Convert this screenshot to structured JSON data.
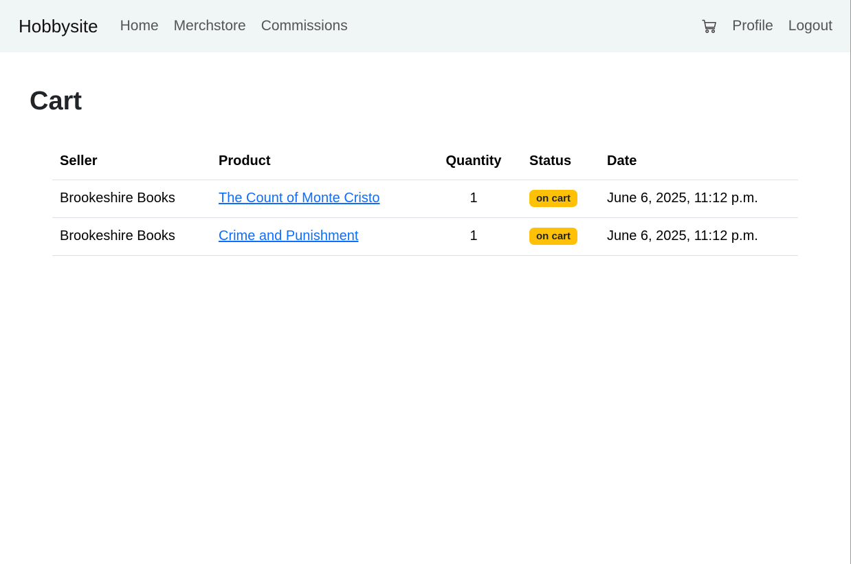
{
  "navbar": {
    "brand": "Hobbysite",
    "links": [
      "Home",
      "Merchstore",
      "Commissions"
    ],
    "cart_icon": "cart-icon",
    "profile": "Profile",
    "logout": "Logout"
  },
  "page": {
    "title": "Cart"
  },
  "table": {
    "headers": {
      "seller": "Seller",
      "product": "Product",
      "quantity": "Quantity",
      "status": "Status",
      "date": "Date"
    },
    "rows": [
      {
        "seller": "Brookeshire Books",
        "product": "The Count of Monte Cristo",
        "quantity": "1",
        "status": "on cart",
        "date": "June 6, 2025, 11:12 p.m."
      },
      {
        "seller": "Brookeshire Books",
        "product": "Crime and Punishment",
        "quantity": "1",
        "status": "on cart",
        "date": "June 6, 2025, 11:12 p.m."
      }
    ]
  },
  "colors": {
    "navbar_bg": "#f0f5f5",
    "link": "#0d6efd",
    "badge": "#ffc107"
  }
}
